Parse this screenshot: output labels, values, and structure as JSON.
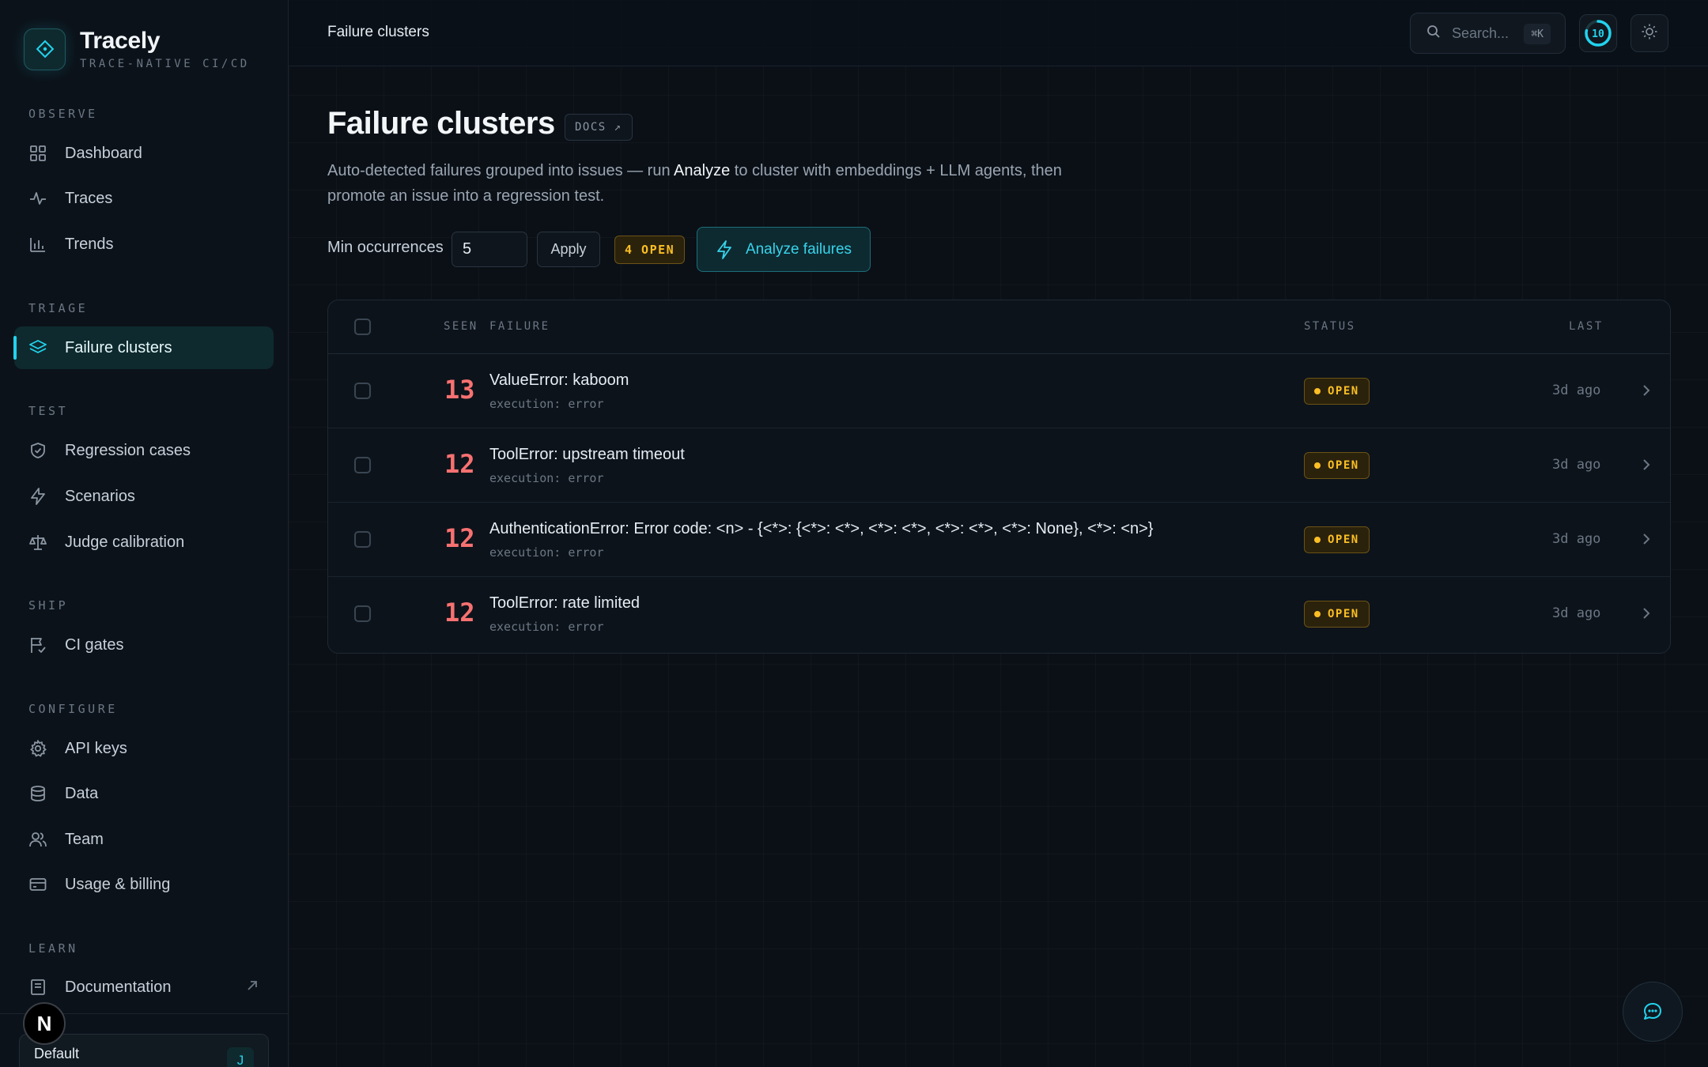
{
  "brand": {
    "name": "Tracely",
    "tagline": "TRACE-NATIVE CI/CD"
  },
  "sidebar": {
    "sections": {
      "observe": "OBSERVE",
      "triage": "TRIAGE",
      "test": "TEST",
      "ship": "SHIP",
      "configure": "CONFIGURE",
      "learn": "LEARN"
    },
    "items": {
      "dashboard": "Dashboard",
      "traces": "Traces",
      "trends": "Trends",
      "failure_clusters": "Failure clusters",
      "regression_cases": "Regression cases",
      "scenarios": "Scenarios",
      "judge_calibration": "Judge calibration",
      "ci_gates": "CI gates",
      "api_keys": "API keys",
      "data": "Data",
      "team": "Team",
      "usage_billing": "Usage & billing",
      "documentation": "Documentation"
    },
    "workspace": {
      "name": "Default",
      "avatar": "J"
    },
    "n_badge": "N"
  },
  "topbar": {
    "title": "Failure clusters",
    "search_placeholder": "Search...",
    "search_shortcut": "⌘K",
    "ring_value": "10"
  },
  "page": {
    "title": "Failure clusters",
    "docs_label": "DOCS ↗",
    "description_pre": "Auto-detected failures grouped into issues — run ",
    "description_highlight": "Analyze",
    "description_post": " to cluster with embeddings + LLM agents, then promote an issue into a regression test.",
    "filter_label": "Min occurrences",
    "filter_value": "5",
    "apply_label": "Apply",
    "open_count": "4 OPEN",
    "analyze_label": "Analyze failures"
  },
  "table": {
    "headers": {
      "seen": "SEEN",
      "failure": "FAILURE",
      "status": "STATUS",
      "last": "LAST"
    },
    "rows": [
      {
        "seen": "13",
        "title": "ValueError: kaboom",
        "sub": "execution: error",
        "status": "OPEN",
        "last": "3d ago"
      },
      {
        "seen": "12",
        "title": "ToolError: upstream timeout",
        "sub": "execution: error",
        "status": "OPEN",
        "last": "3d ago"
      },
      {
        "seen": "12",
        "title": "AuthenticationError: Error code: <n> - {<*>: {<*>: <*>, <*>: <*>, <*>: <*>, <*>: None}, <*>: <n>}",
        "sub": "execution: error",
        "status": "OPEN",
        "last": "3d ago"
      },
      {
        "seen": "12",
        "title": "ToolError: rate limited",
        "sub": "execution: error",
        "status": "OPEN",
        "last": "3d ago"
      }
    ]
  },
  "colors": {
    "accent": "#22d3ee",
    "warning": "#fbbf24",
    "error": "#f87171",
    "background": "#0b1017"
  }
}
